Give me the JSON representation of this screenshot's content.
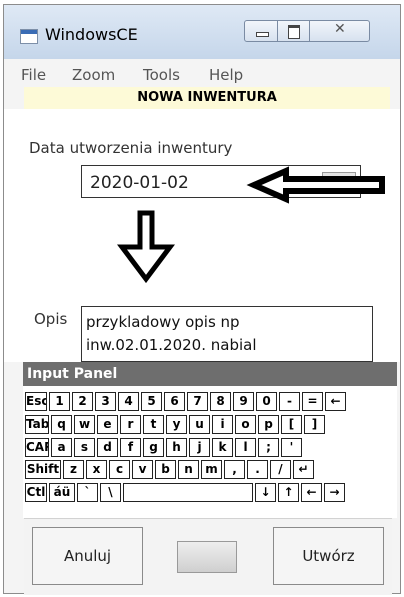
{
  "window": {
    "title": "WindowsCE"
  },
  "menu": [
    "File",
    "Zoom",
    "Tools",
    "Help"
  ],
  "banner": "NOWA INWENTURA",
  "form": {
    "date_label": "Data utworzenia inwentury",
    "date_value": "2020-01-02",
    "desc_label": "Opis",
    "desc_lines": [
      "przykladowy opis np",
      "inw.02.01.2020. nabial"
    ]
  },
  "input_panel": {
    "title": "Input Panel"
  },
  "keyboard": {
    "rows": [
      [
        "Esc",
        "1",
        "2",
        "3",
        "4",
        "5",
        "6",
        "7",
        "8",
        "9",
        "0",
        "-",
        "=",
        "←"
      ],
      [
        "Tab",
        "q",
        "w",
        "e",
        "r",
        "t",
        "y",
        "u",
        "i",
        "o",
        "p",
        "[",
        "]"
      ],
      [
        "CAP",
        "a",
        "s",
        "d",
        "f",
        "g",
        "h",
        "j",
        "k",
        "l",
        ";",
        "'"
      ],
      [
        "Shift",
        "z",
        "x",
        "c",
        "v",
        "b",
        "n",
        "m",
        ",",
        ".",
        "/",
        "↵"
      ],
      [
        "Ctl",
        "áü",
        "`",
        "\\",
        " ",
        "↓",
        "↑",
        "←",
        "→"
      ]
    ]
  },
  "buttons": {
    "cancel": "Anuluj",
    "create": "Utwórz"
  }
}
